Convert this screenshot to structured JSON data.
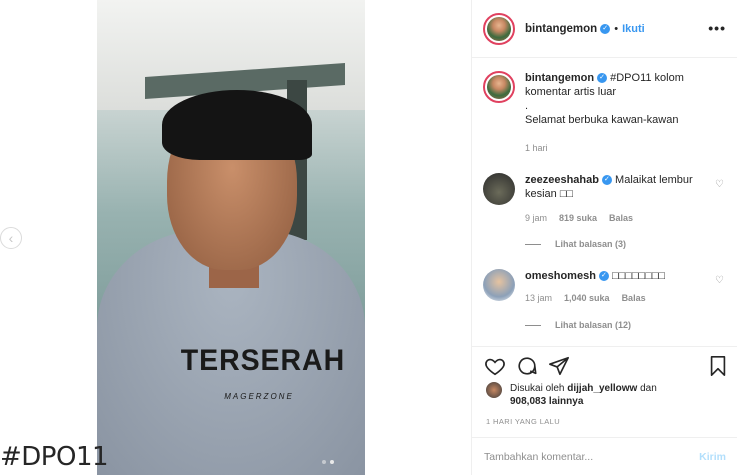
{
  "post": {
    "hashtag_overlay": "#DPO11",
    "shirt_text": "TERSERAH",
    "shirt_subtext": "MAGERZONE",
    "carousel": {
      "total_slides": 2,
      "active_slide": 2
    },
    "prev_icon": "chevron-left-icon"
  },
  "header": {
    "username": "bintangemon",
    "separator": "•",
    "follow_label": "Ikuti",
    "more_label": "•••"
  },
  "caption": {
    "username": "bintangemon",
    "text_line1": "#DPO11 kolom komentar artis luar",
    "text_line2": ".",
    "text_line3": "Selamat berbuka kawan-kawan",
    "time": "1 hari"
  },
  "comments": [
    {
      "username": "zeezeeshahab",
      "text": "Malaikat lembur kesian □□",
      "time": "9 jam",
      "likes": "819 suka",
      "reply_label": "Balas",
      "view_replies": "Lihat balasan (3)"
    },
    {
      "username": "omeshomesh",
      "text": "□□□□□□□□",
      "time": "13 jam",
      "likes": "1,040 suka",
      "reply_label": "Balas",
      "view_replies": "Lihat balasan (12)"
    }
  ],
  "actions": {
    "liked_by_prefix": "Disukai oleh",
    "liked_by_user": "dijjah_yelloww",
    "liked_by_and": "dan",
    "liked_by_count": "908,083 lainnya",
    "time_ago": "1 HARI YANG LALU",
    "comment_placeholder": "Tambahkan komentar...",
    "post_label": "Kirim"
  },
  "colors": {
    "accent": "#3897f0",
    "story_ring": "#e0415f",
    "muted": "#8e8e8e",
    "post_disabled": "#b2dffc"
  }
}
